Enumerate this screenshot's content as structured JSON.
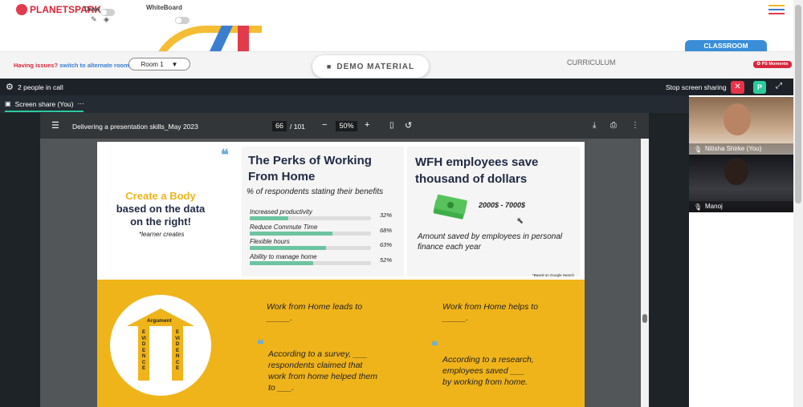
{
  "app": {
    "logo": "PLANETSPARK",
    "draw_label": "Draw",
    "whiteboard_label": "WhiteBoard"
  },
  "room_bar": {
    "issue_text": "Having issues?",
    "switch_link": "switch to alternate room",
    "room_select": "Room 1",
    "demo_tab": "DEMO MATERIAL",
    "curriculum_tab": "CURRICULUM",
    "classroom_tab": "CLASSROOM",
    "moments_badge": "PS Moments"
  },
  "call": {
    "people_count": "2 people in call",
    "stop_sharing": "Stop screen sharing",
    "p_button": "P",
    "share_tab": "Screen share (You)"
  },
  "pdf": {
    "title": "Delivering a presentation skills_May 2023",
    "page_current": "66",
    "page_total": "/ 101",
    "zoom": "50%"
  },
  "slide": {
    "left_title_1": "Create a Body",
    "left_title_2": "based on the data",
    "left_title_3": "on the right!",
    "left_note": "*learner creates",
    "perks_title_1": "The Perks of Working",
    "perks_title_2": "From Home",
    "perks_subtitle": "% of respondents stating their benefits",
    "bars": [
      {
        "label": "Increased productivity",
        "value": "32%",
        "pct": 32
      },
      {
        "label": "Reduce Commute Time",
        "value": "68%",
        "pct": 68
      },
      {
        "label": "Flexible hours",
        "value": "63%",
        "pct": 63
      },
      {
        "label": "Ability to manage home",
        "value": "52%",
        "pct": 52
      }
    ],
    "wfh_title_1": "WFH employees save",
    "wfh_title_2": "thousand of dollars",
    "wfh_amount": "2000$ - 7000$",
    "wfh_desc_1": "Amount saved by employees in personal",
    "wfh_desc_2": "finance each year",
    "source": "*Based on Google Search",
    "argument": "Argument",
    "evidence": "EVIDENCE",
    "leads_1": "Work from Home leads to",
    "leads_2": "_____.",
    "helps_1": "Work from Home helps to",
    "helps_2": "_____.",
    "survey_1": "According to a survey, ___",
    "survey_2": "respondents claimed that",
    "survey_3": "work from home helped them",
    "survey_4": "to ___.",
    "research_1": "According to a research,",
    "research_2": "employees saved ___",
    "research_3": "by working from home."
  },
  "participants": [
    {
      "name": "Nitisha Shirke (You)"
    },
    {
      "name": "Manoj"
    }
  ],
  "colors": {
    "brand_red": "#d8263a",
    "link_blue": "#3a7ed0",
    "teal": "#2bcb9c",
    "slide_yellow": "#f0b41b",
    "bar_green": "#6cc4a0"
  }
}
